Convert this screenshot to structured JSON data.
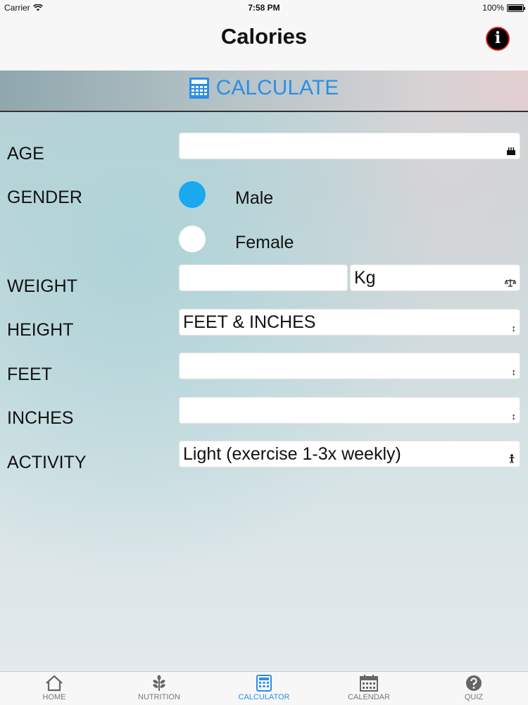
{
  "status_bar": {
    "carrier": "Carrier",
    "time": "7:58 PM",
    "battery": "100%"
  },
  "nav": {
    "title": "Calories"
  },
  "calculate": {
    "label": "CALCULATE"
  },
  "form": {
    "age": {
      "label": "AGE",
      "value": ""
    },
    "gender": {
      "label": "GENDER",
      "options": [
        "Male",
        "Female"
      ],
      "selected": "Male"
    },
    "weight": {
      "label": "WEIGHT",
      "value": "",
      "unit": "Kg"
    },
    "height": {
      "label": "HEIGHT",
      "value": "FEET & INCHES"
    },
    "feet": {
      "label": "FEET",
      "value": ""
    },
    "inches": {
      "label": "INCHES",
      "value": ""
    },
    "activity": {
      "label": "ACTIVITY",
      "value": "Light (exercise 1-3x weekly)"
    }
  },
  "tabs": [
    {
      "label": "HOME",
      "icon": "home-icon"
    },
    {
      "label": "NUTRITION",
      "icon": "leaf-icon"
    },
    {
      "label": "CALCULATOR",
      "icon": "calculator-icon"
    },
    {
      "label": "CALENDAR",
      "icon": "calendar-icon"
    },
    {
      "label": "QUIZ",
      "icon": "question-icon"
    }
  ],
  "active_tab": "CALCULATOR",
  "colors": {
    "accent": "#2a8ee8",
    "radio_selected": "#1aa9ee",
    "info_border": "#d22222"
  }
}
